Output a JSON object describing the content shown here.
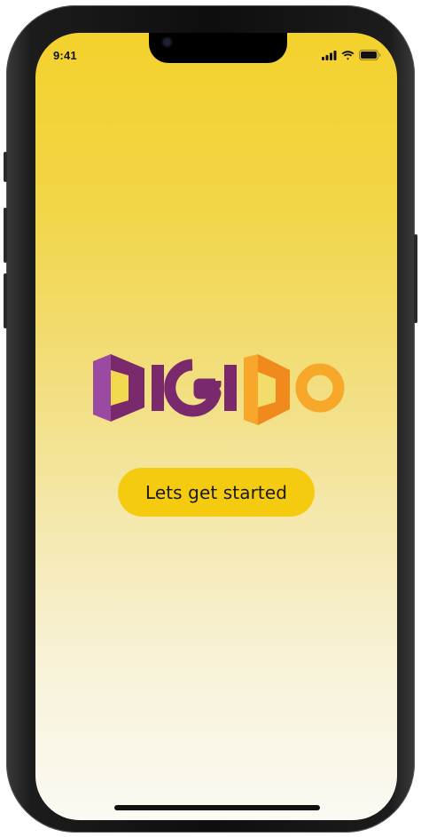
{
  "status_bar": {
    "time": "9:41",
    "icons": [
      "cellular-signal-icon",
      "wifi-icon",
      "battery-icon"
    ]
  },
  "logo": {
    "text": "DIGIDO",
    "colors": {
      "purple_light": "#9a4aa0",
      "purple": "#7a2a6c",
      "purple_dark": "#5e1f52",
      "orange_light": "#f7a82a",
      "orange": "#f08a1c",
      "orange_dark": "#e0701c"
    }
  },
  "cta_button": {
    "label": "Lets get started",
    "color": "#f5cb10"
  },
  "theme": {
    "background_top": "#f3d22d",
    "background_bottom": "#fbfaf3"
  }
}
